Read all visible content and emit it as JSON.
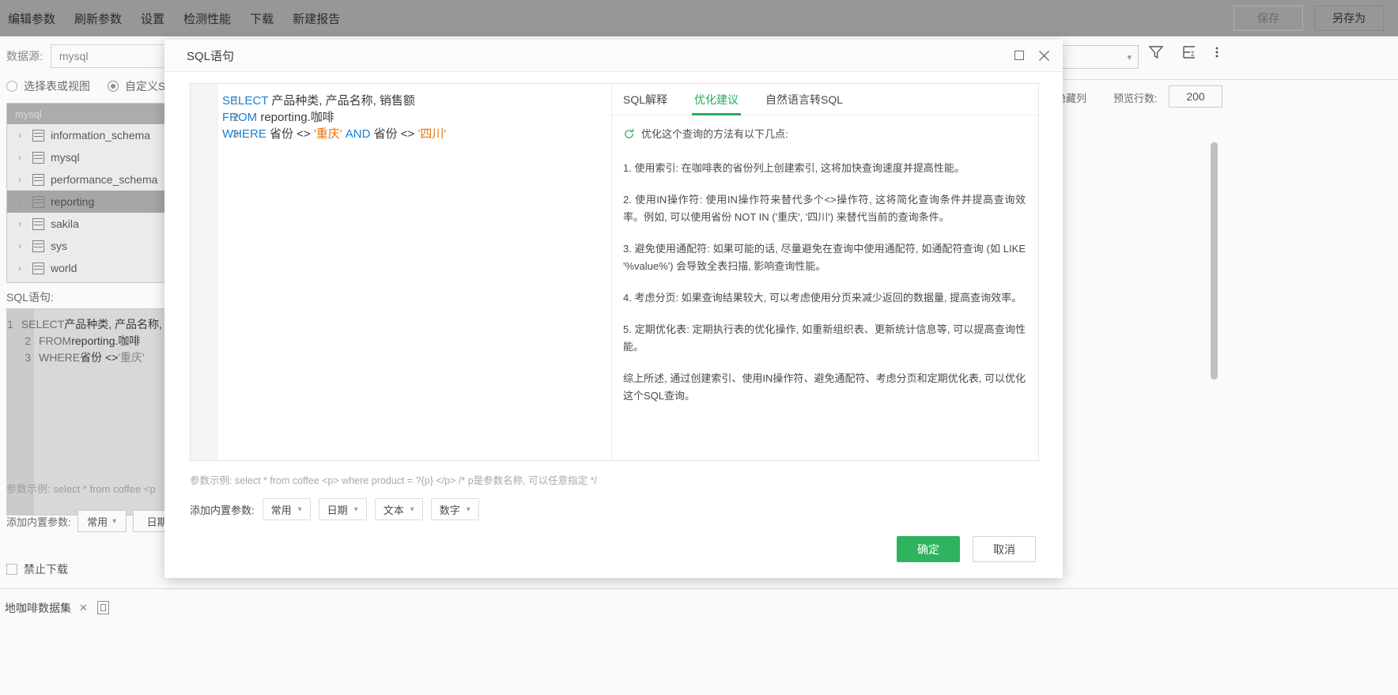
{
  "toolbar": {
    "menu_items": [
      "编辑参数",
      "刷新参数",
      "设置",
      "检测性能",
      "下载",
      "新建报告"
    ],
    "save_label": "保存",
    "save_as_label": "另存为"
  },
  "datasource": {
    "label": "数据源:",
    "value": "mysql",
    "radio_table": "选择表或视图",
    "radio_custom": "自定义SQL语",
    "tree_header": "mysql",
    "tree_items": [
      {
        "label": "information_schema",
        "selected": false
      },
      {
        "label": "mysql",
        "selected": false
      },
      {
        "label": "performance_schema",
        "selected": false
      },
      {
        "label": "reporting",
        "selected": true
      },
      {
        "label": "sakila",
        "selected": false
      },
      {
        "label": "sys",
        "selected": false
      },
      {
        "label": "world",
        "selected": false
      }
    ],
    "sql_label": "SQL语句:",
    "hint": "参数示例: select * from coffee <p",
    "param_label": "添加内置参数:",
    "param_buttons": [
      "常用",
      "日期"
    ],
    "no_download_label": "禁止下载"
  },
  "right_panel": {
    "hidden_cols_label": "示隐藏列",
    "preview_rows_label": "预览行数:",
    "preview_rows_value": "200"
  },
  "bottom": {
    "tab_label": "地咖啡数据集",
    "tab_close": "✕"
  },
  "modal": {
    "title": "SQL语句",
    "maximize_icon": "maximize-icon",
    "close_icon": "close-icon",
    "editor": {
      "lines": [
        {
          "num": "1",
          "tokens": [
            {
              "t": "SELECT",
              "c": "kw"
            },
            {
              "t": " 产品种类, 产品名称, 销售额",
              "c": "plain"
            }
          ]
        },
        {
          "num": "2",
          "tokens": [
            {
              "t": "FROM",
              "c": "kw"
            },
            {
              "t": " reporting.咖啡",
              "c": "plain"
            }
          ]
        },
        {
          "num": "3",
          "tokens": [
            {
              "t": "WHERE",
              "c": "kw"
            },
            {
              "t": " 省份 <> ",
              "c": "plain"
            },
            {
              "t": "'重庆'",
              "c": "str"
            },
            {
              "t": " AND",
              "c": "kw"
            },
            {
              "t": " 省份 <> ",
              "c": "plain"
            },
            {
              "t": "'四川'",
              "c": "str"
            }
          ]
        }
      ]
    },
    "tabs": [
      {
        "label": "SQL解释",
        "active": false
      },
      {
        "label": "优化建议",
        "active": true
      },
      {
        "label": "自然语言转SQL",
        "active": false
      }
    ],
    "advice": {
      "intro": "优化这个查询的方法有以下几点:",
      "items": [
        "1. 使用索引: 在咖啡表的省份列上创建索引, 这将加快查询速度并提高性能。",
        "2. 使用IN操作符: 使用IN操作符来替代多个<>操作符, 这将简化查询条件并提高查询效率。例如, 可以使用省份 NOT IN ('重庆', '四川') 来替代当前的查询条件。",
        "3. 避免使用通配符: 如果可能的话, 尽量避免在查询中使用通配符, 如通配符查询 (如 LIKE '%value%') 会导致全表扫描, 影响查询性能。",
        "4. 考虑分页: 如果查询结果较大, 可以考虑使用分页来减少返回的数据量, 提高查询效率。",
        "5. 定期优化表: 定期执行表的优化操作, 如重新组织表、更新统计信息等, 可以提高查询性能。",
        "综上所述, 通过创建索引、使用IN操作符、避免通配符、考虑分页和定期优化表, 可以优化这个SQL查询。"
      ]
    },
    "param_hint": "参数示例: select * from coffee <p> where product = ?{p} </p> /* p是参数名称, 可以任意指定 */",
    "param_label": "添加内置参数:",
    "param_buttons": [
      "常用",
      "日期",
      "文本",
      "数字"
    ],
    "confirm_label": "确定",
    "cancel_label": "取消"
  },
  "colors": {
    "accent_green": "#2fb35f",
    "keyword_blue": "#1a7fd4",
    "string_orange": "#e8730a"
  }
}
